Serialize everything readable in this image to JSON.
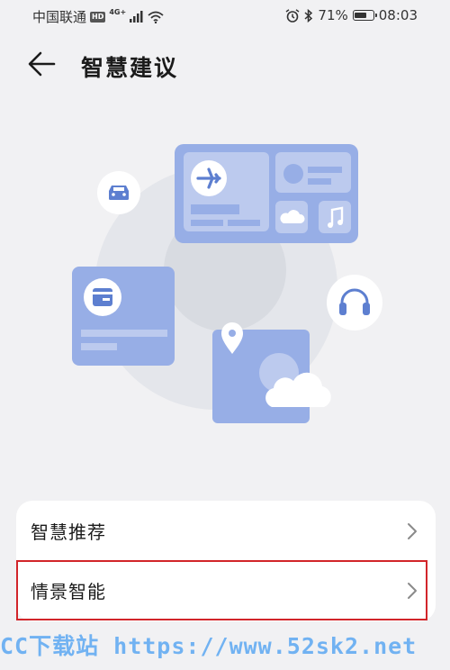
{
  "status_bar": {
    "carrier": "中国联通",
    "hd_badge": "HD",
    "network_type": "4G+",
    "battery": "71%",
    "battery_level": 0.71,
    "time": "08:03",
    "icons": [
      "signal-icon",
      "wifi-icon",
      "alarm-icon",
      "bluetooth-icon",
      "battery-icon"
    ]
  },
  "header": {
    "title": "智慧建议",
    "back_icon": "arrow-left-icon"
  },
  "illustration": {
    "accent": "#97aee6",
    "icons": [
      "car-icon",
      "airplane-icon",
      "cloud-icon",
      "music-note-icon",
      "wallet-icon",
      "headphones-icon",
      "location-pin-icon",
      "weather-cloud-icon"
    ]
  },
  "menu": {
    "items": [
      {
        "label": "智慧推荐"
      },
      {
        "label": "情景智能"
      }
    ]
  },
  "colors": {
    "background": "#f1f1f3",
    "card": "#ffffff",
    "illustration_blue": "#97aee6",
    "highlight_border": "#d2252a",
    "watermark": "#5ba8f2"
  },
  "watermark": "CC下载站 https://www.52sk2.net"
}
